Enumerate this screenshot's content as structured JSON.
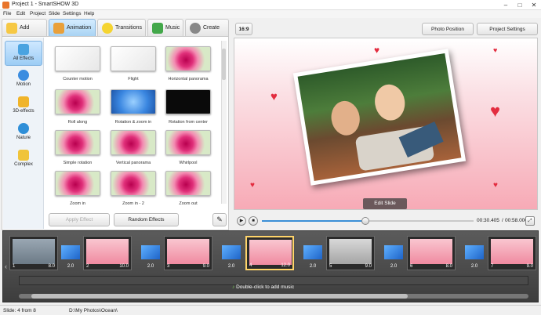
{
  "window": {
    "title": "Project 1 - SmartSHOW 3D"
  },
  "menu": [
    "File",
    "Edit",
    "Project",
    "Slide",
    "Settings",
    "Help"
  ],
  "tabs": [
    {
      "label": "Add",
      "icon": "folder-icon"
    },
    {
      "label": "Animation",
      "icon": "palette-icon",
      "active": true
    },
    {
      "label": "Transitions",
      "icon": "star-icon"
    },
    {
      "label": "Music",
      "icon": "music-note-icon"
    },
    {
      "label": "Create",
      "icon": "create-icon"
    }
  ],
  "categories": [
    {
      "label": "All Effects",
      "active": true
    },
    {
      "label": "Motion"
    },
    {
      "label": "3D-effects"
    },
    {
      "label": "Nature"
    },
    {
      "label": "Complex"
    }
  ],
  "effects": [
    {
      "label": "Counter motion",
      "style": "white"
    },
    {
      "label": "Flight",
      "style": "white"
    },
    {
      "label": "Horizontal panorama",
      "style": "pink"
    },
    {
      "label": "Roll along",
      "style": "pink"
    },
    {
      "label": "Rotation & zoom in",
      "style": "blue"
    },
    {
      "label": "Rotation from center",
      "style": "dark"
    },
    {
      "label": "Simple rotation",
      "style": "pink"
    },
    {
      "label": "Vertical panorama",
      "style": "pink"
    },
    {
      "label": "Whirlpool",
      "style": "pink"
    },
    {
      "label": "Zoom in",
      "style": "pink"
    },
    {
      "label": "Zoom in - 2",
      "style": "pink"
    },
    {
      "label": "Zoom out",
      "style": "pink"
    }
  ],
  "buttons": {
    "apply": "Apply Effect",
    "random": "Random Effects"
  },
  "toolbar": {
    "aspect": "16:9",
    "photo_position": "Photo Position",
    "project_settings": "Project Settings"
  },
  "preview": {
    "edit_slide": "Edit Slide"
  },
  "player": {
    "time_current": "00:30.405",
    "time_total": "00:58.000",
    "progress": 0.49
  },
  "timeline": {
    "slides": [
      {
        "num": "1",
        "duration": "8.0"
      },
      {
        "num": "2",
        "duration": "10.0"
      },
      {
        "num": "3",
        "duration": "9.0"
      },
      {
        "num": "4",
        "duration": "12.0",
        "active": true
      },
      {
        "num": "5",
        "duration": "9.0"
      },
      {
        "num": "6",
        "duration": "8.0"
      },
      {
        "num": "7",
        "duration": "9.0"
      }
    ],
    "transitions": [
      "2.0",
      "2.0",
      "2.0",
      "2.0",
      "2.0",
      "2.0",
      "2.0"
    ],
    "music_hint": "Double-click to add music"
  },
  "status": {
    "slide": "Slide: 4 from 8",
    "path": "D:\\My Photos\\Ocean\\"
  }
}
